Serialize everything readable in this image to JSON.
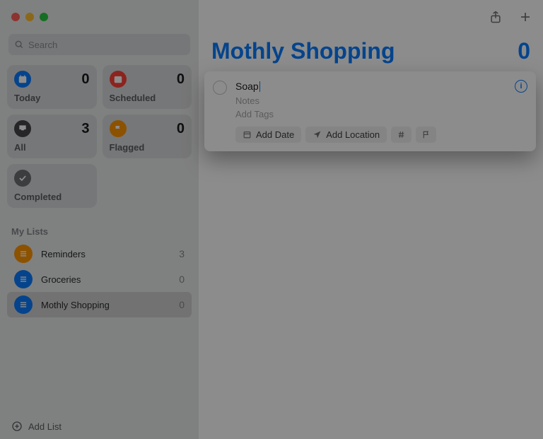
{
  "search": {
    "placeholder": "Search"
  },
  "cards": {
    "today": {
      "label": "Today",
      "count": "0"
    },
    "scheduled": {
      "label": "Scheduled",
      "count": "0"
    },
    "all": {
      "label": "All",
      "count": "3"
    },
    "flagged": {
      "label": "Flagged",
      "count": "0"
    },
    "completed": {
      "label": "Completed"
    }
  },
  "lists": {
    "section_title": "My Lists",
    "items": [
      {
        "name": "Reminders",
        "count": "3"
      },
      {
        "name": "Groceries",
        "count": "0"
      },
      {
        "name": "Mothly Shopping",
        "count": "0"
      }
    ]
  },
  "footer": {
    "add_list": "Add List"
  },
  "main": {
    "title": "Mothly Shopping",
    "total": "0"
  },
  "reminder": {
    "title": "Soap",
    "notes_placeholder": "Notes",
    "tags_placeholder": "Add Tags",
    "add_date": "Add Date",
    "add_location": "Add Location"
  }
}
